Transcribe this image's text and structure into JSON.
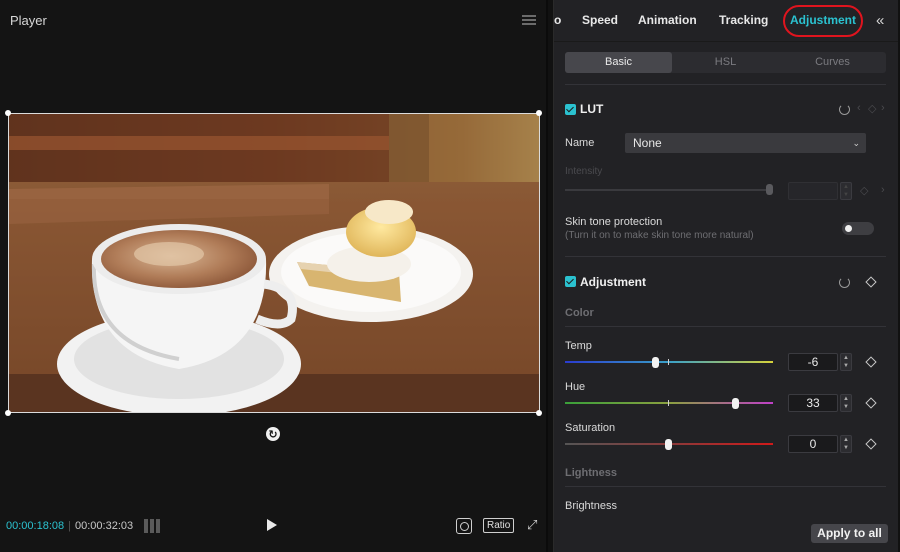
{
  "player": {
    "title": "Player",
    "time_current": "00:00:18:08",
    "time_separator": "|",
    "time_total": "00:00:32:03",
    "ratio_label": "Ratio"
  },
  "inspector": {
    "tabs": [
      {
        "label": "o"
      },
      {
        "label": "Speed"
      },
      {
        "label": "Animation"
      },
      {
        "label": "Tracking"
      },
      {
        "label": "Adjustment",
        "active": true
      }
    ],
    "subtabs": [
      {
        "label": "Basic",
        "active": true
      },
      {
        "label": "HSL"
      },
      {
        "label": "Curves"
      }
    ],
    "lut": {
      "title": "LUT",
      "enabled": true,
      "name_label": "Name",
      "name_value": "None",
      "intensity_label": "Intensity",
      "skin_label": "Skin tone protection",
      "skin_hint": "(Turn it on to make skin tone more natural)",
      "skin_enabled": false
    },
    "adjustment": {
      "title": "Adjustment",
      "enabled": true,
      "color_header": "Color",
      "sliders": [
        {
          "label": "Temp",
          "value": "-6",
          "level": 0.47
        },
        {
          "label": "Hue",
          "value": "33",
          "level": 0.83
        },
        {
          "label": "Saturation",
          "value": "0",
          "level": 0.5
        }
      ],
      "lightness_header": "Lightness",
      "brightness_label": "Brightness"
    },
    "apply_all_label": "Apply to all",
    "colors": {
      "accent": "#2bc2d0",
      "highlight_ring": "#e0141e"
    }
  }
}
